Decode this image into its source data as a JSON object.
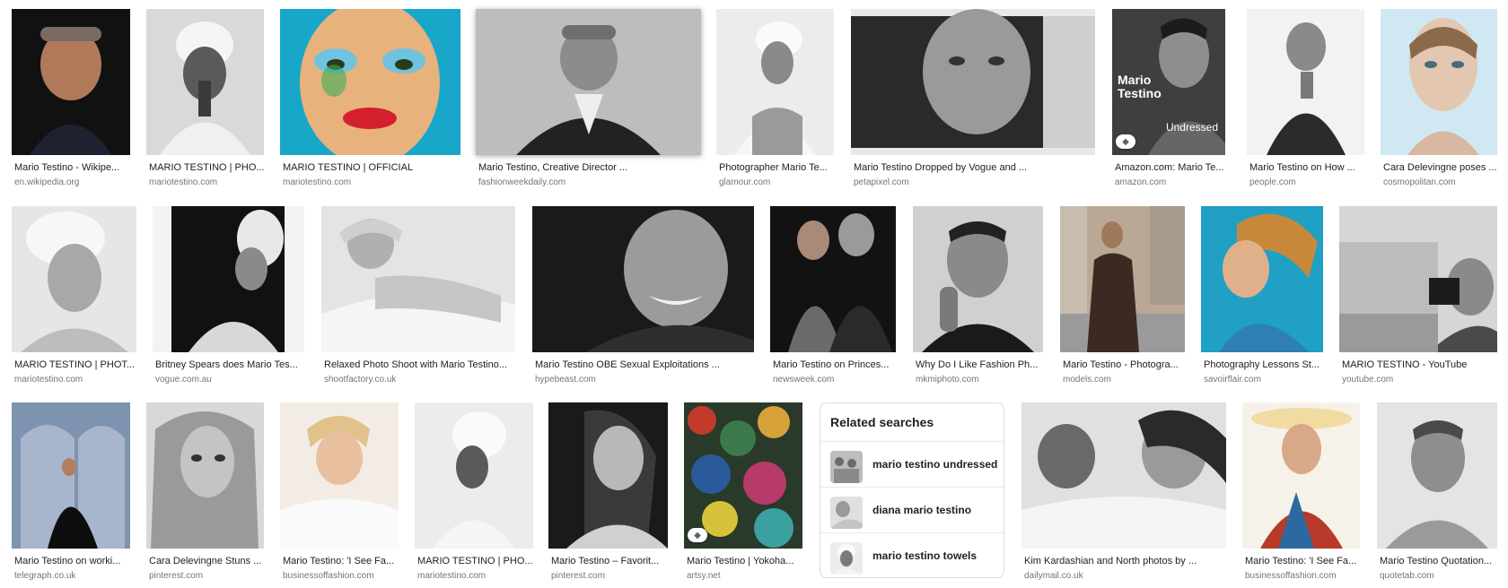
{
  "rows": [
    {
      "tiles": [
        {
          "title": "Mario Testino - Wikipe...",
          "source": "en.wikipedia.org",
          "icon": "portrait-photo",
          "tag": false
        },
        {
          "title": "MARIO TESTINO | PHO...",
          "source": "mariotestino.com",
          "icon": "towel-portrait-photo",
          "tag": false
        },
        {
          "title": "MARIO TESTINO | OFFICIAL",
          "source": "mariotestino.com",
          "icon": "colorful-face-photo",
          "tag": false
        },
        {
          "title": "Mario Testino, Creative Director ...",
          "source": "fashionweekdaily.com",
          "icon": "portrait-photo",
          "tag": false
        },
        {
          "title": "Photographer Mario Te...",
          "source": "glamour.com",
          "icon": "towel-portrait-photo",
          "tag": false
        },
        {
          "title": "Mario Testino Dropped by Vogue and ...",
          "source": "petapixel.com",
          "icon": "close-up-portrait-photo",
          "tag": false
        },
        {
          "title": "Amazon.com: Mario Te...",
          "source": "amazon.com",
          "icon": "book-cover-photo",
          "tag": true,
          "cover_title": "Mario Testino",
          "cover_subtitle": "Undressed"
        },
        {
          "title": "Mario Testino on How ...",
          "source": "people.com",
          "icon": "portrait-photo",
          "tag": false
        },
        {
          "title": "Cara Delevingne poses ...",
          "source": "cosmopolitan.com",
          "icon": "portrait-photo",
          "tag": false
        }
      ]
    },
    {
      "tiles": [
        {
          "title": "MARIO TESTINO | PHOT...",
          "source": "mariotestino.com",
          "icon": "towel-portrait-photo",
          "tag": false
        },
        {
          "title": "Britney Spears does Mario Tes...",
          "source": "vogue.com.au",
          "icon": "towel-portrait-photo",
          "tag": false
        },
        {
          "title": "Relaxed Photo Shoot with Mario Testino...",
          "source": "shootfactory.co.uk",
          "icon": "reclining-portrait-photo",
          "tag": false
        },
        {
          "title": "Mario Testino OBE Sexual Exploitations ...",
          "source": "hypebeast.com",
          "icon": "close-up-portrait-photo",
          "tag": false
        },
        {
          "title": "Mario Testino on Princes...",
          "source": "newsweek.com",
          "icon": "couple-photo",
          "tag": false
        },
        {
          "title": "Why Do I Like Fashion Ph...",
          "source": "mkmiphoto.com",
          "icon": "portrait-photo",
          "tag": false
        },
        {
          "title": "Mario Testino - Photogra...",
          "source": "models.com",
          "icon": "street-photo",
          "tag": false
        },
        {
          "title": "Photography Lessons St...",
          "source": "savoirflair.com",
          "icon": "colorful-portrait-photo",
          "tag": false
        },
        {
          "title": "MARIO TESTINO - YouTube",
          "source": "youtube.com",
          "icon": "photographer-photo",
          "tag": false
        }
      ]
    },
    {
      "tiles": [
        {
          "title": "Mario Testino on worki...",
          "source": "telegraph.co.uk",
          "icon": "palace-photo",
          "tag": false
        },
        {
          "title": "Cara Delevingne Stuns ...",
          "source": "pinterest.com",
          "icon": "portrait-photo",
          "tag": false
        },
        {
          "title": "Mario Testino: 'I See Fa...",
          "source": "businessoffashion.com",
          "icon": "reclining-portrait-photo",
          "tag": false
        },
        {
          "title": "MARIO TESTINO | PHO...",
          "source": "mariotestino.com",
          "icon": "towel-portrait-photo",
          "tag": false
        },
        {
          "title": "Mario Testino – Favorit...",
          "source": "pinterest.com",
          "icon": "portrait-photo",
          "tag": false
        },
        {
          "title": "Mario Testino | Yokoha...",
          "source": "artsy.net",
          "icon": "patterned-art-photo",
          "tag": true
        },
        {
          "title": "Kim Kardashian and North photos by ...",
          "source": "dailymail.co.uk",
          "icon": "mother-child-photo",
          "tag": false
        },
        {
          "title": "Mario Testino: 'I See Fa...",
          "source": "businessoffashion.com",
          "icon": "colorful-portrait-photo",
          "tag": false
        },
        {
          "title": "Mario Testino Quotation...",
          "source": "quotetab.com",
          "icon": "portrait-photo",
          "tag": false
        }
      ]
    }
  ],
  "related": {
    "heading": "Related searches",
    "items": [
      {
        "label": "mario testino undressed",
        "icon": "group-photo-thumb"
      },
      {
        "label": "diana mario testino",
        "icon": "portrait-thumb"
      },
      {
        "label": "mario testino towels",
        "icon": "towel-portrait-thumb"
      }
    ]
  },
  "tag_icon": "tag-icon",
  "colors": {
    "caption": "#202124",
    "source": "#70757a",
    "border": "#dadce0"
  }
}
